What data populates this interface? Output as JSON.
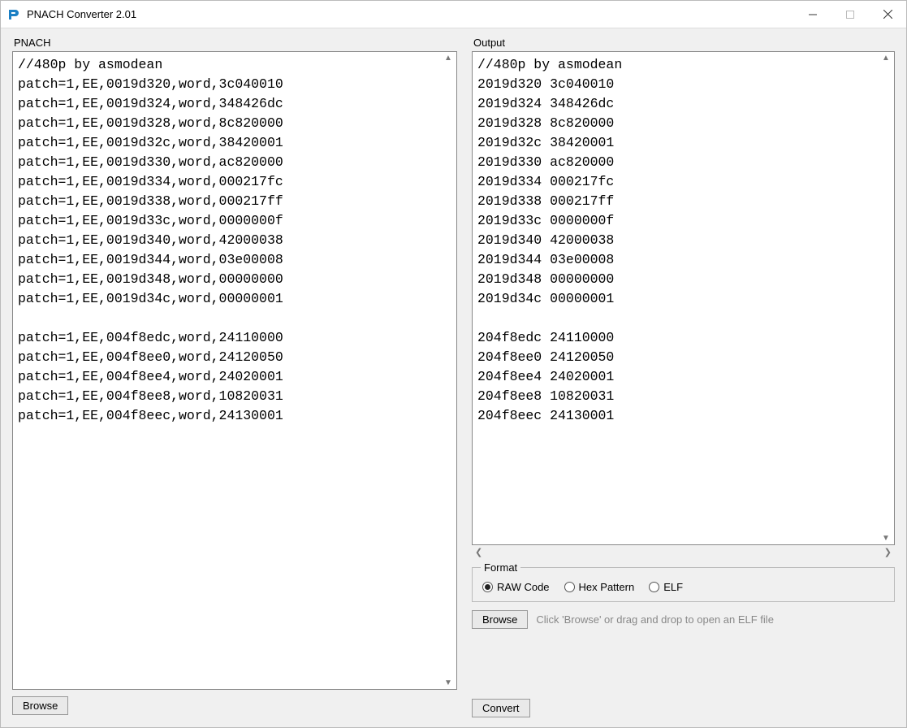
{
  "title": "PNACH Converter 2.01",
  "labels": {
    "pnach": "PNACH",
    "output": "Output",
    "format_group": "Format",
    "browse": "Browse",
    "convert": "Convert",
    "elf_hint": "Click 'Browse' or drag and drop to open an ELF file"
  },
  "format_options": {
    "raw": "RAW Code",
    "hex": "Hex Pattern",
    "elf": "ELF",
    "selected": "raw"
  },
  "pnach_text": "//480p by asmodean\npatch=1,EE,0019d320,word,3c040010\npatch=1,EE,0019d324,word,348426dc\npatch=1,EE,0019d328,word,8c820000\npatch=1,EE,0019d32c,word,38420001\npatch=1,EE,0019d330,word,ac820000\npatch=1,EE,0019d334,word,000217fc\npatch=1,EE,0019d338,word,000217ff\npatch=1,EE,0019d33c,word,0000000f\npatch=1,EE,0019d340,word,42000038\npatch=1,EE,0019d344,word,03e00008\npatch=1,EE,0019d348,word,00000000\npatch=1,EE,0019d34c,word,00000001\n\npatch=1,EE,004f8edc,word,24110000\npatch=1,EE,004f8ee0,word,24120050\npatch=1,EE,004f8ee4,word,24020001\npatch=1,EE,004f8ee8,word,10820031\npatch=1,EE,004f8eec,word,24130001",
  "output_text": "//480p by asmodean\n2019d320 3c040010\n2019d324 348426dc\n2019d328 8c820000\n2019d32c 38420001\n2019d330 ac820000\n2019d334 000217fc\n2019d338 000217ff\n2019d33c 0000000f\n2019d340 42000038\n2019d344 03e00008\n2019d348 00000000\n2019d34c 00000001\n\n204f8edc 24110000\n204f8ee0 24120050\n204f8ee4 24020001\n204f8ee8 10820031\n204f8eec 24130001"
}
